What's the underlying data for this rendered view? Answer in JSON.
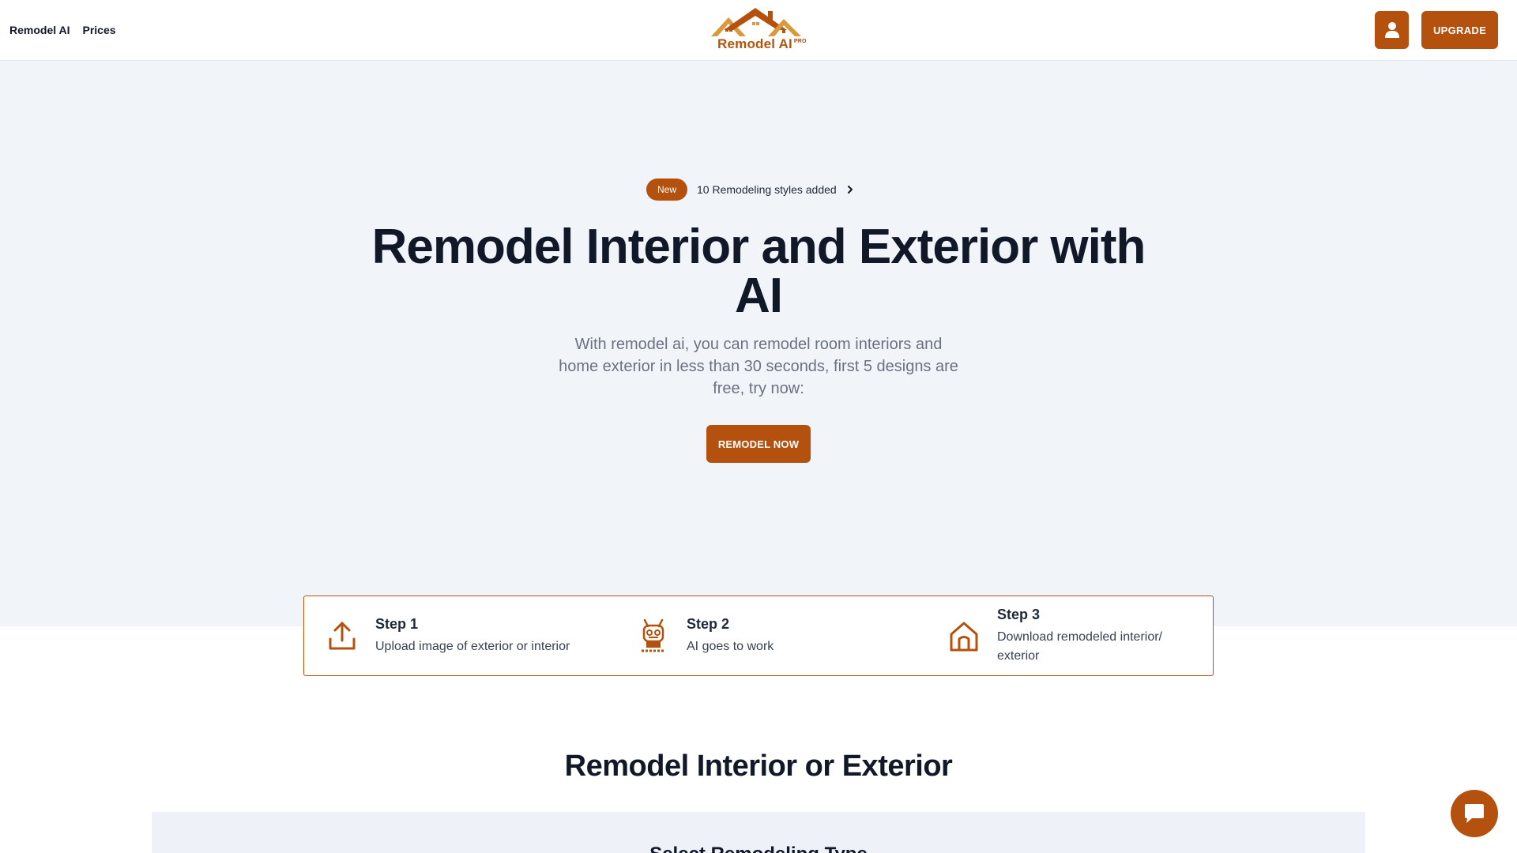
{
  "nav": {
    "links": [
      "Remodel AI",
      "Prices"
    ],
    "logo_text": "Remodel AI",
    "logo_badge": "PRO",
    "upgrade_label": "UPGRADE",
    "user_icon": "user-icon"
  },
  "hero": {
    "badge": "New",
    "announcement": "10 Remodeling styles added",
    "title": "Remodel Interior and Exterior with AI",
    "subtitle": "With remodel ai, you can remodel room interiors and home exterior in less than 30 seconds, first 5 designs are free, try now:",
    "cta_label": "REMODEL NOW"
  },
  "steps": [
    {
      "title": "Step 1",
      "desc": "Upload image of exterior or interior",
      "icon": "upload-icon"
    },
    {
      "title": "Step 2",
      "desc": "AI goes to work",
      "icon": "robot-icon"
    },
    {
      "title": "Step 3",
      "desc": "Download remodeled interior/ exterior",
      "icon": "home-icon"
    }
  ],
  "section": {
    "title": "Remodel Interior or Exterior",
    "panel_title": "Select Remodeling Type"
  },
  "colors": {
    "accent": "#b4510e",
    "hero_bg": "#f1f4f9",
    "text_dark": "#111827",
    "text_muted": "#6b7280"
  }
}
